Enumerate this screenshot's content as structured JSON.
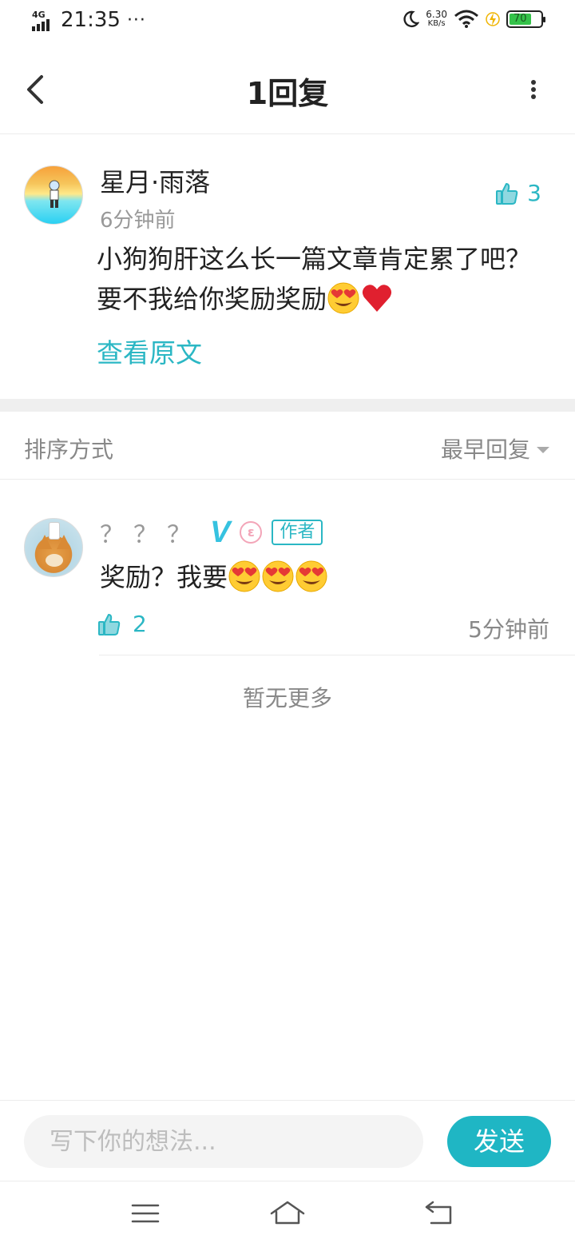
{
  "status_bar": {
    "network": "4G",
    "time": "21:35",
    "dots": "···",
    "speed_value": "6.30",
    "speed_unit": "KB/s",
    "battery_level": "70",
    "battery_color": "#35c24a"
  },
  "header": {
    "title": "1回复",
    "back_icon": "chevron-left-icon",
    "more_icon": "more-vertical-icon"
  },
  "original_comment": {
    "username": "星月·雨落",
    "time": "6分钟前",
    "like_count": "3",
    "text": "小狗狗肝这么长一篇文章肯定累了吧？要不我给你奖励奖励",
    "emojis": [
      "heart-eyes-emoji",
      "red-heart-emoji"
    ],
    "view_original_label": "查看原文"
  },
  "sort": {
    "label": "排序方式",
    "selected": "最早回复"
  },
  "reply": {
    "username": "？？？",
    "v_badge": "V",
    "level_badge": "ε",
    "author_badge": "作者",
    "text": "奖励？我要",
    "emojis": [
      "heart-eyes-emoji",
      "heart-eyes-emoji",
      "heart-eyes-emoji"
    ],
    "like_count": "2",
    "time": "5分钟前"
  },
  "no_more_text": "暂无更多",
  "input_bar": {
    "placeholder": "写下你的想法...",
    "send_label": "发送"
  },
  "colors": {
    "accent": "#2bb7c4",
    "send_button": "#1fb6c4",
    "text_primary": "#222222",
    "text_secondary": "#999999"
  }
}
